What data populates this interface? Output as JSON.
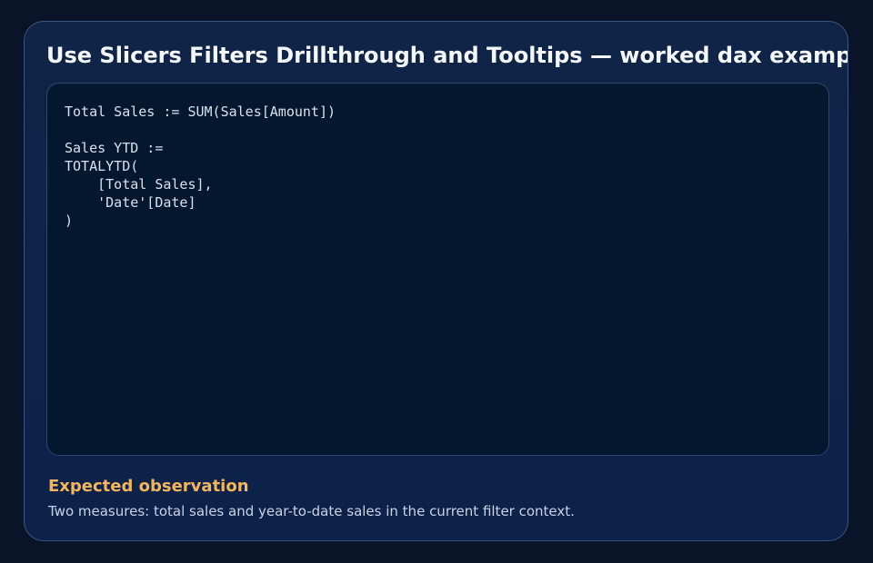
{
  "card": {
    "title": "Use Slicers Filters Drillthrough and Tooltips — worked dax example",
    "code": "Total Sales := SUM(Sales[Amount])\n\nSales YTD :=\nTOTALYTD(\n    [Total Sales],\n    'Date'[Date]\n)",
    "observation": {
      "heading": "Expected observation",
      "text": "Two measures: total sales and year-to-date sales in the current filter context."
    }
  },
  "colors": {
    "background": "#0a1428",
    "card": "#0e2348",
    "code_panel": "#03172e",
    "accent": "#f5b55b",
    "title": "#f4f7fc"
  }
}
